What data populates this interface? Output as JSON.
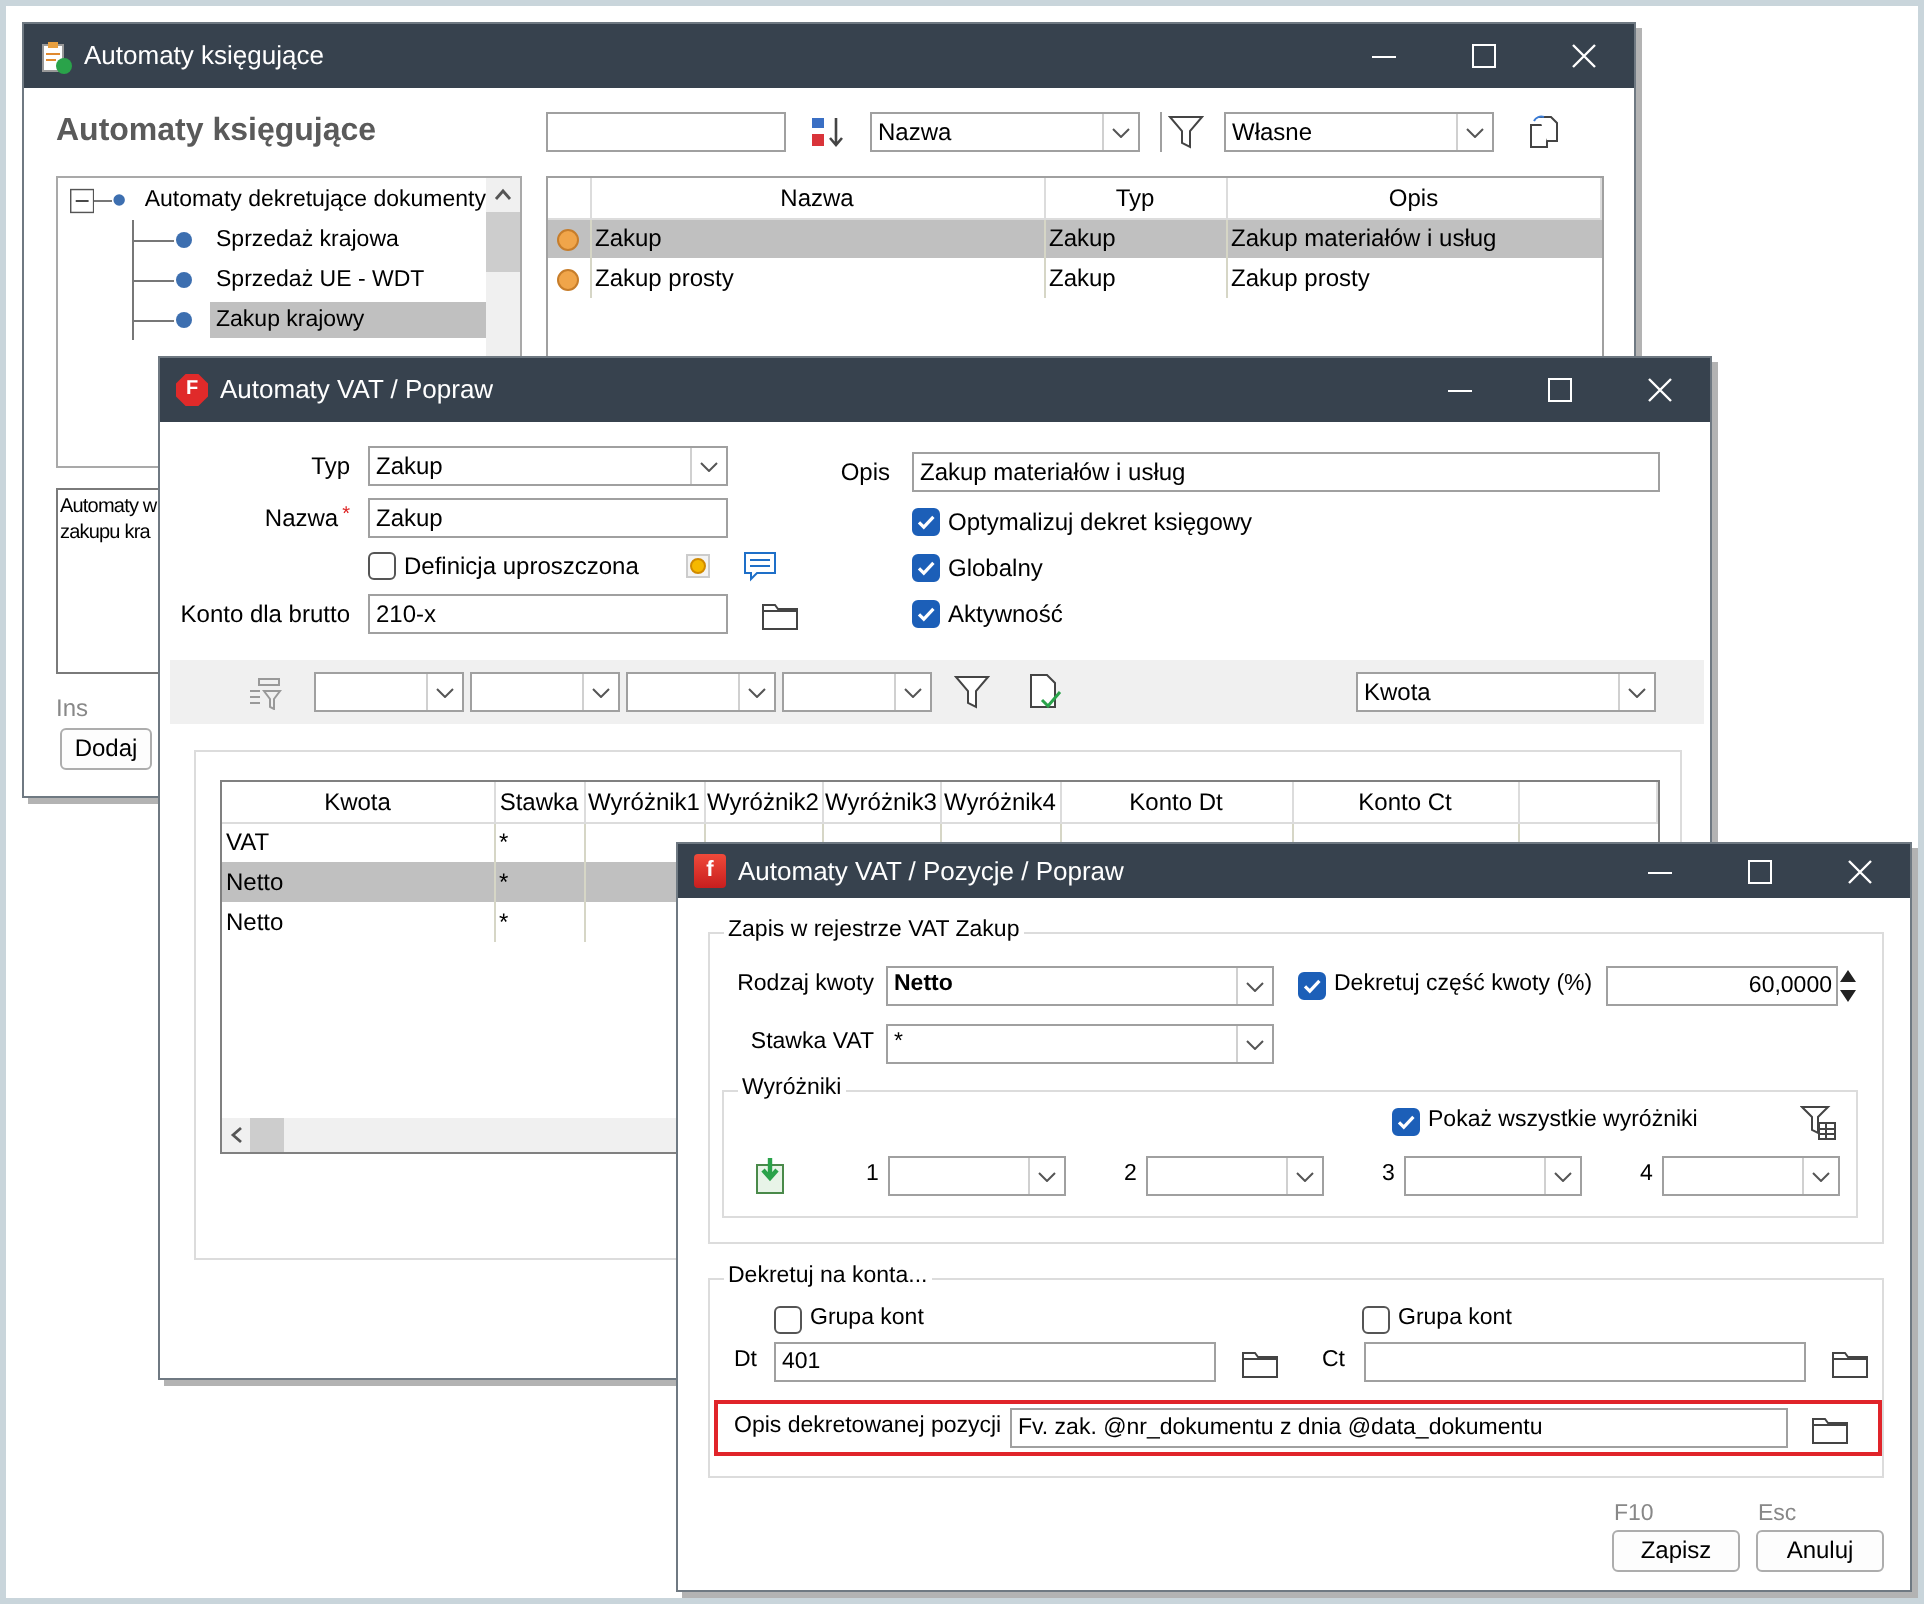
{
  "list_window": {
    "title": "Automaty księgujące",
    "heading": "Automaty księgujące",
    "sort_field": "Nazwa",
    "filter_field": "Własne",
    "tree": [
      {
        "label": "Automaty dekretujące dokumenty",
        "expanded": true,
        "selected": false,
        "children": [
          {
            "label": "Sprzedaż krajowa",
            "selected": false
          },
          {
            "label": "Sprzedaż UE - WDT",
            "selected": false
          },
          {
            "label": "Zakup krajowy",
            "selected": true
          }
        ]
      }
    ],
    "table": {
      "columns": [
        "Nazwa",
        "Typ",
        "Opis"
      ],
      "rows": [
        {
          "cells": [
            "Zakup",
            "Zakup",
            "Zakup materiałów i usług"
          ],
          "selected": true
        },
        {
          "cells": [
            "Zakup prosty",
            "Zakup",
            "Zakup prosty"
          ],
          "selected": false
        }
      ]
    },
    "description_lines": [
      "Automaty w",
      "zakupu kra"
    ],
    "add_shortcut": "Ins",
    "add_button": "Dodaj"
  },
  "vat_window": {
    "logo_letter": "F",
    "title": "Automaty VAT / Popraw",
    "type_label": "Typ",
    "type": "Zakup",
    "name_label": "Nazwa",
    "required_mark": "*",
    "name": "Zakup",
    "simplified": {
      "label": "Definicja uproszczona",
      "checked": false
    },
    "gross_label": "Konto dla brutto",
    "gross_account": "210-x",
    "description_label": "Opis",
    "description": "Zakup materiałów i usług",
    "options": [
      {
        "label": "Optymalizuj dekret księgowy",
        "checked": true
      },
      {
        "label": "Globalny",
        "checked": true
      },
      {
        "label": "Aktywność",
        "checked": true
      }
    ],
    "amount_field": "Kwota",
    "table": {
      "columns": [
        "Kwota",
        "Stawka",
        "Wyróżnik1",
        "Wyróżnik2",
        "Wyróżnik3",
        "Wyróżnik4",
        "Konto Dt",
        "Konto Ct"
      ],
      "rows": [
        {
          "amount": "VAT",
          "rate": "*",
          "selected": false
        },
        {
          "amount": "Netto",
          "rate": "*",
          "selected": true
        },
        {
          "amount": "Netto",
          "rate": "*",
          "selected": false
        }
      ]
    }
  },
  "position_window": {
    "logo_letter": "f",
    "title": "Automaty VAT / Pozycje / Popraw",
    "register_group": {
      "legend": "Zapis w rejestrze VAT Zakup",
      "amount_type_label": "Rodzaj kwoty",
      "amount_type": "Netto",
      "partial": {
        "label": "Dekretuj część kwoty (%)",
        "checked": true
      },
      "percent": "60,0000",
      "rate_label": "Stawka VAT",
      "rate": "*",
      "markers": {
        "legend": "Wyróżniki",
        "show_all": {
          "label": "Pokaż wszystkie wyróżniki",
          "checked": true
        },
        "slots": [
          "1",
          "2",
          "3",
          "4"
        ]
      }
    },
    "accounts_group": {
      "legend": "Dekretuj na konta...",
      "debit": {
        "group": {
          "label": "Grupa kont",
          "checked": false
        },
        "label": "Dt",
        "account": "401"
      },
      "credit": {
        "group": {
          "label": "Grupa kont",
          "checked": false
        },
        "label": "Ct"
      },
      "entry_description": {
        "label": "Opis dekretowanej pozycji",
        "value": "Fv. zak. @nr_dokumentu z dnia @data_dokumentu",
        "highlighted": true
      }
    },
    "buttons": [
      {
        "shortcut": "F10",
        "label": "Zapisz"
      },
      {
        "shortcut": "Esc",
        "label": "Anuluj"
      }
    ]
  }
}
